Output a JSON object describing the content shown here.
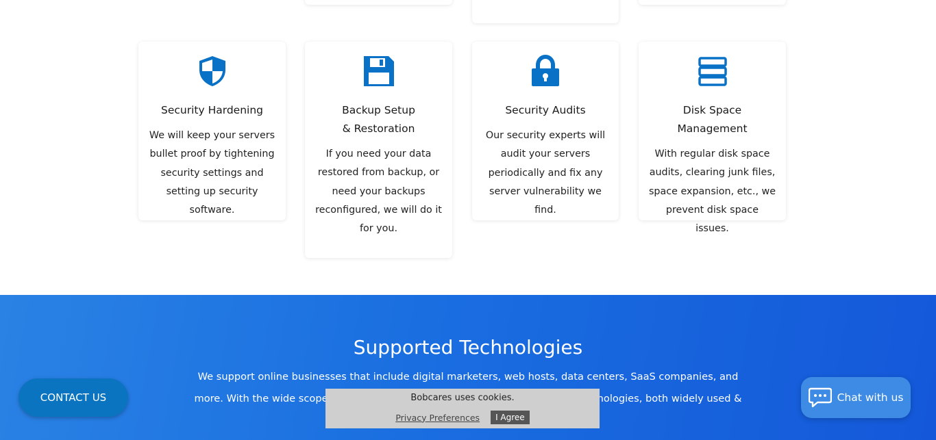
{
  "cards": [
    {
      "title": "Security Hardening",
      "text": "We will keep your servers bullet proof by tightening security settings and setting up security software.",
      "icon": "shield-icon"
    },
    {
      "title": "Backup Setup & Restoration",
      "text": "If you need your data restored from backup, or need your backups reconfigured, we will do it for you.",
      "icon": "floppy-disk-icon"
    },
    {
      "title": "Security Audits",
      "text": "Our security experts will audit your servers periodically and fix any server vulnerability we find.",
      "icon": "lock-icon"
    },
    {
      "title": "Disk Space Management",
      "text": "With regular disk space audits, clearing junk files, space expansion, etc., we prevent disk space issues.",
      "icon": "server-stack-icon"
    }
  ],
  "tech": {
    "title": "Supported Technologies",
    "text": "We support online businesses that include digital marketers, web hosts, data centers, SaaS companies, and more. With the wide scope of services we offer, we support a wide range of technologies, both widely used &"
  },
  "contact_label": "CONTACT US",
  "chat_label": "Chat with us",
  "cookie": {
    "message": "Bobcares uses cookies.",
    "preferences": "Privacy Preferences",
    "agree": "I Agree"
  },
  "colors": {
    "accent": "#0a72c6",
    "band": "#1a6ee0"
  }
}
